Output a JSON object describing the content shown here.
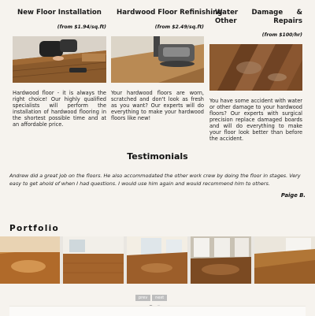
{
  "services": [
    {
      "title": "New Floor Installation",
      "price": "(from $1.94/sq.ft)",
      "description": "Hardwood floor - it is always the right choice! Our highly qualified specialists will perform the installation of hardwood flooring in the shortest possible time and at an affordable price."
    },
    {
      "title": "Hardwood Floor Refinishing",
      "price": "(from $2.49/sq.ft)",
      "description": "Your hardwood floors are worn, scratched and don't look as fresh as you want? Our experts will do everything to make your hardwood floors like new!"
    },
    {
      "title": "Water Damage & Other Repairs",
      "price": "(from $100/hr)",
      "description": "You have some accident with water or other damage to your hardwood floors? Our experts with surgical precision replace damaged boards and will do everything to make your floor look better than before the accident."
    }
  ],
  "testimonials": {
    "heading": "Testimonials",
    "quote": "Andrew did a great job on the floors. He also accommodated the other work crew by doing the floor in stages. Very easy to get ahold of when I had questions. I would use him again and would recommend him to others.",
    "author": "Paige B."
  },
  "portfolio": {
    "heading": "Portfolio",
    "prev_label": "prev",
    "next_label": "next",
    "slide_count": 2,
    "active_slide": 1
  },
  "colors": {
    "background": "#f6f3ee",
    "dot_active": "#9e9e9e",
    "dot_inactive": "#d4d4d4"
  }
}
